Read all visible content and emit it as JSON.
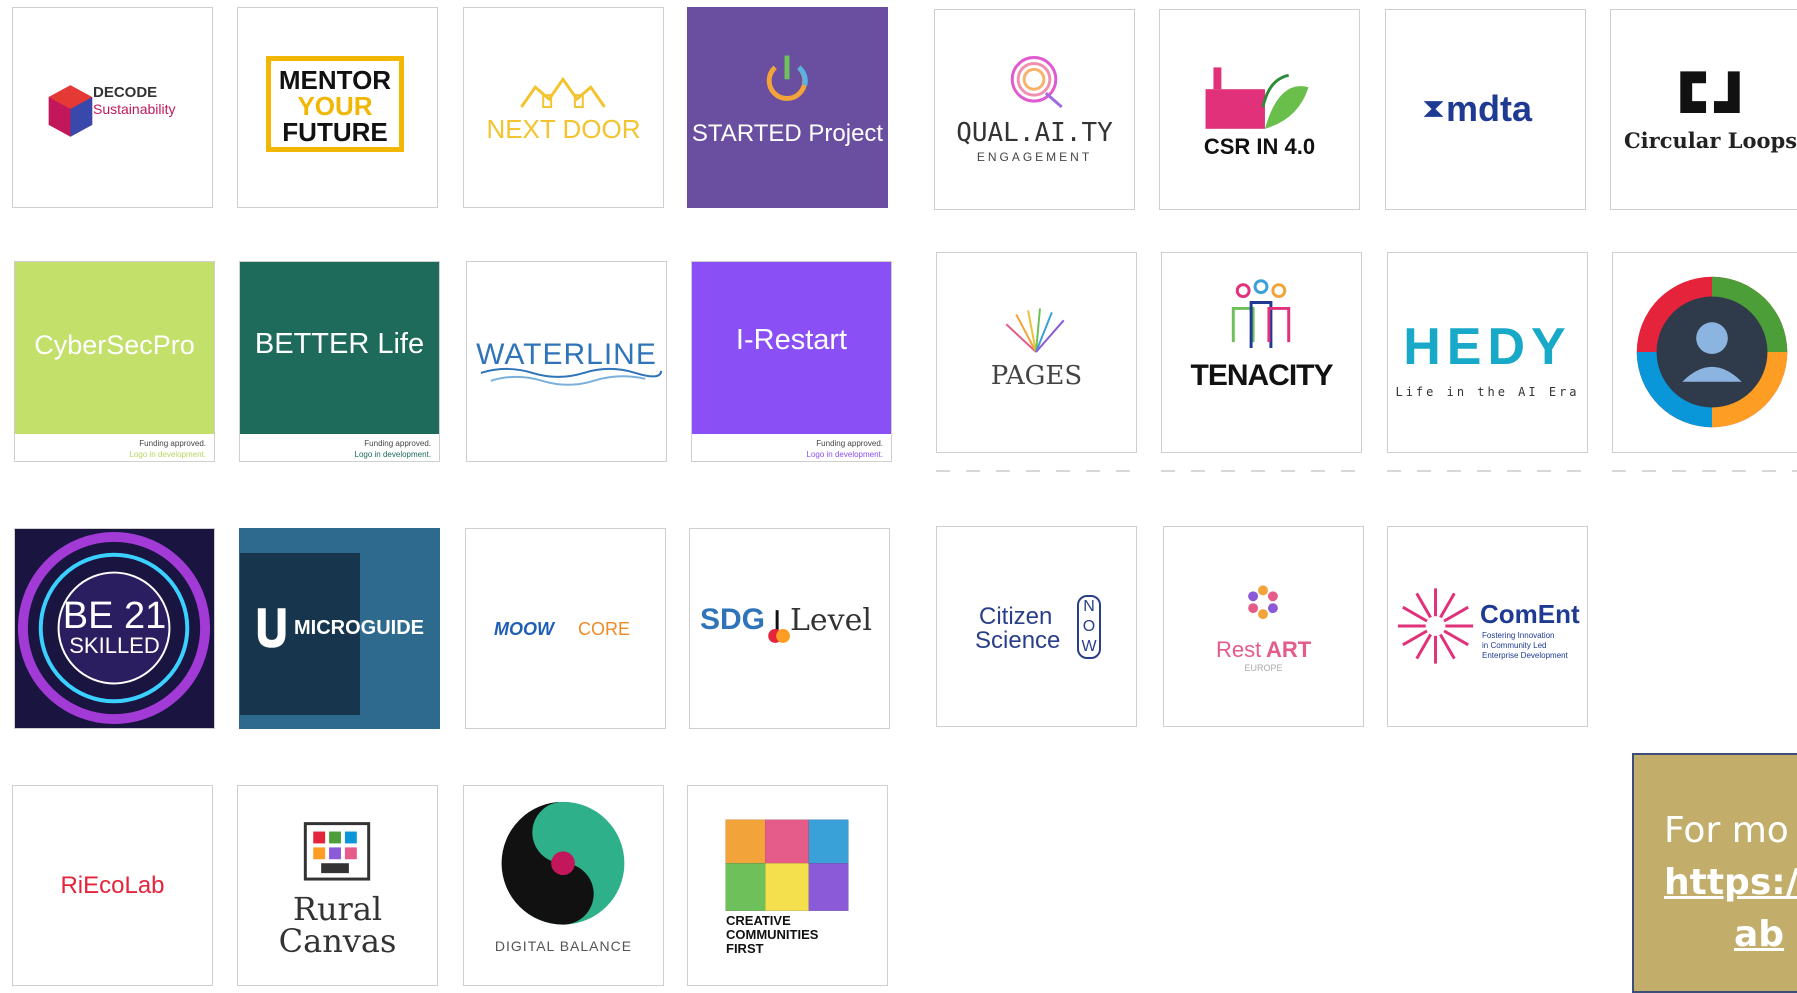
{
  "logos": {
    "decode": {
      "title": "DECODE",
      "subtitle": "Sustainability"
    },
    "mentor": {
      "l1": "MENTOR",
      "l2": "YOUR",
      "l3": "FUTURE"
    },
    "nextdoor": {
      "label": "NEXT DOOR"
    },
    "started": {
      "label": "STARTED Project"
    },
    "quality": {
      "label": "QUAL.AI.TY",
      "sub": "ENGAGEMENT"
    },
    "csr": {
      "label": "CSR IN 4.0"
    },
    "mdta": {
      "label": "mdta"
    },
    "circular": {
      "label": "Circular Loops"
    },
    "cybersec": {
      "label": "CyberSecPro"
    },
    "better": {
      "label": "BETTER Life"
    },
    "waterline": {
      "label": "WATERLINE"
    },
    "irestart": {
      "label": "I-Restart"
    },
    "pages": {
      "label": "PAGES"
    },
    "tenacity": {
      "label": "TENACITY"
    },
    "hedy": {
      "label": "HEDY",
      "sub": "Life in the AI Era"
    },
    "be21": {
      "l1": "BE 21",
      "l2": "SKILLED"
    },
    "microguide": {
      "label": "MICROGUIDE"
    },
    "moow": {
      "label": "MOOW",
      "label2": "CORE"
    },
    "sdg": {
      "l1": "SDG",
      "l2": "Level"
    },
    "citizen": {
      "l1": "Citizen",
      "l2": "Science",
      "l3": "NOW"
    },
    "restart": {
      "l1": "Rest",
      "l2": "ART",
      "sub": "EUROPE"
    },
    "coment": {
      "label": "ComEnt",
      "sub1": "Fostering Innovation",
      "sub2": "in Community Led",
      "sub3": "Enterprise Development"
    },
    "riecolab": {
      "label": "RiEcoLab"
    },
    "rural": {
      "l1": "Rural",
      "l2": "Canvas"
    },
    "digital": {
      "label": "DIGITAL BALANCE"
    },
    "creative": {
      "l1": "CREATIVE",
      "l2": "COMMUNITIES",
      "l3": "FIRST"
    }
  },
  "notes": {
    "approved": "Funding approved.",
    "dev": "Logo in development."
  },
  "info": {
    "line1": "For mo",
    "line2": "https:/",
    "line3": "ab"
  },
  "colors": {
    "started_bg": "#6a4fa0",
    "cyber_bg": "#c3e06a",
    "better_bg": "#1e6b5c",
    "irestart_bg": "#8a4ff5",
    "microguide_bg": "#2e6a8e",
    "info_bg": "#c2ad6b"
  }
}
